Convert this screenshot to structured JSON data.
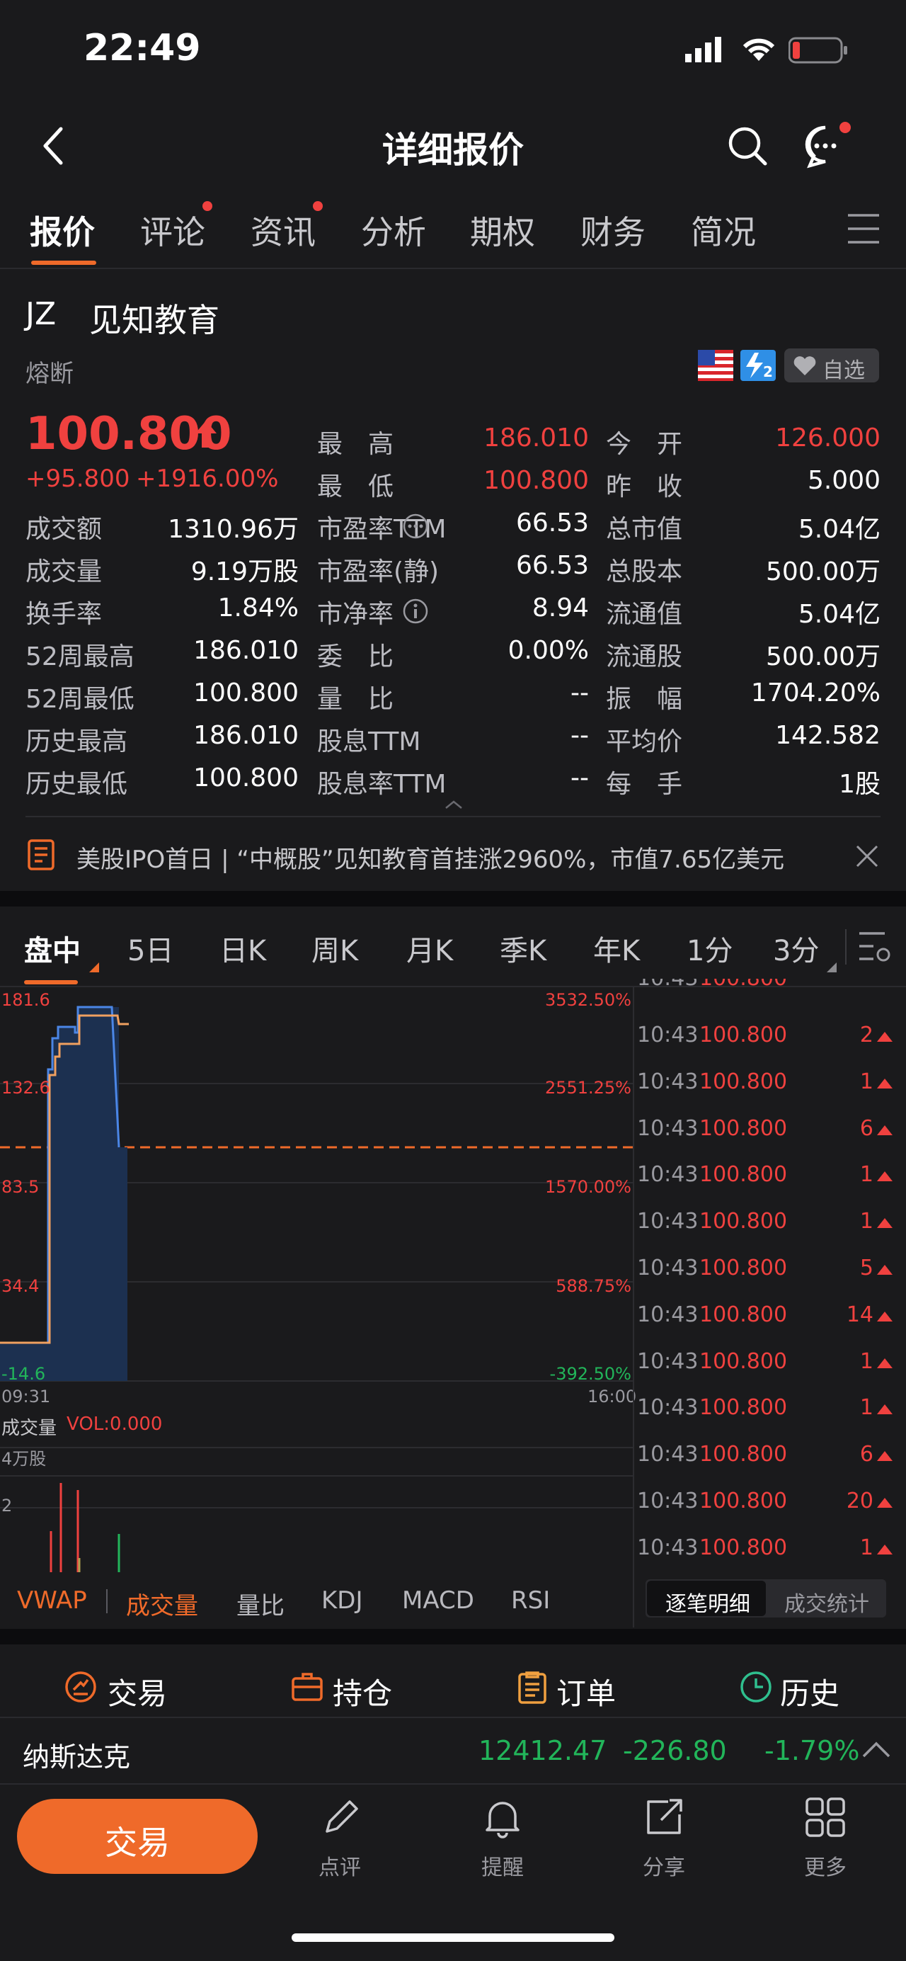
{
  "status": {
    "time": "22:49"
  },
  "nav": {
    "title": "详细报价"
  },
  "tabs": [
    "报价",
    "评论",
    "资讯",
    "分析",
    "期权",
    "财务",
    "简况"
  ],
  "stock": {
    "ticker": "JZ",
    "name": "见知教育",
    "state": "熔断",
    "watch_label": "自选",
    "price": "100.800",
    "change": "+95.800",
    "change_pct": "+1916.00%"
  },
  "quote_top": [
    {
      "label": "最　高",
      "value": "186.010",
      "color": "red",
      "label2": "今　开",
      "value2": "126.000",
      "color2": "red"
    },
    {
      "label": "最　低",
      "value": "100.800",
      "color": "red",
      "label2": "昨　收",
      "value2": "5.000",
      "color2": "white"
    }
  ],
  "quote_rows": [
    {
      "l1": "成交额",
      "v1": "1310.96万",
      "l2": "市盈率TTM",
      "v2": "66.53",
      "l3": "总市值",
      "v3": "5.04亿"
    },
    {
      "l1": "成交量",
      "v1": "9.19万股",
      "l2": "市盈率(静)",
      "v2": "66.53",
      "l3": "总股本",
      "v3": "500.00万"
    },
    {
      "l1": "换手率",
      "v1": "1.84%",
      "l2": "市净率",
      "v2": "8.94",
      "l3": "流通值",
      "v3": "5.04亿"
    },
    {
      "l1": "52周最高",
      "v1": "186.010",
      "l2": "委　比",
      "v2": "0.00%",
      "l3": "流通股",
      "v3": "500.00万"
    },
    {
      "l1": "52周最低",
      "v1": "100.800",
      "l2": "量　比",
      "v2": "--",
      "l3": "振　幅",
      "v3": "1704.20%"
    },
    {
      "l1": "历史最高",
      "v1": "186.010",
      "l2": "股息TTM",
      "v2": "--",
      "l3": "平均价",
      "v3": "142.582"
    },
    {
      "l1": "历史最低",
      "v1": "100.800",
      "l2": "股息率TTM",
      "v2": "--",
      "l3": "每　手",
      "v3": "1股"
    }
  ],
  "news": {
    "text": "美股IPO首日 | “中概股”见知教育首挂涨2960%，市值7.65亿美元"
  },
  "periods": [
    "盘中",
    "5日",
    "日K",
    "周K",
    "月K",
    "季K",
    "年K",
    "1分",
    "3分"
  ],
  "chart": {
    "left_ticks": [
      "181.6",
      "132.6",
      "83.5",
      "34.4",
      "-14.6"
    ],
    "right_ticks": [
      "3532.50%",
      "2551.25%",
      "1570.00%",
      "588.75%",
      "-392.50%"
    ],
    "time_start": "09:31",
    "time_end": "16:00",
    "vol_label": "成交量",
    "vol_value": "VOL:0.000",
    "vol_tick_top": "4万股",
    "vol_tick_mid": "2"
  },
  "ticks": [
    {
      "time": "10:43",
      "price": "100.800",
      "vol": "2"
    },
    {
      "time": "10:43",
      "price": "100.800",
      "vol": "1"
    },
    {
      "time": "10:43",
      "price": "100.800",
      "vol": "6"
    },
    {
      "time": "10:43",
      "price": "100.800",
      "vol": "1"
    },
    {
      "time": "10:43",
      "price": "100.800",
      "vol": "1"
    },
    {
      "time": "10:43",
      "price": "100.800",
      "vol": "5"
    },
    {
      "time": "10:43",
      "price": "100.800",
      "vol": "14"
    },
    {
      "time": "10:43",
      "price": "100.800",
      "vol": "1"
    },
    {
      "time": "10:43",
      "price": "100.800",
      "vol": "1"
    },
    {
      "time": "10:43",
      "price": "100.800",
      "vol": "6"
    },
    {
      "time": "10:43",
      "price": "100.800",
      "vol": "20"
    },
    {
      "time": "10:43",
      "price": "100.800",
      "vol": "1"
    }
  ],
  "indicators": [
    "VWAP",
    "成交量",
    "量比",
    "KDJ",
    "MACD",
    "RSI"
  ],
  "tick_tabs": [
    "逐笔明细",
    "成交统计"
  ],
  "actions": [
    "交易",
    "持仓",
    "订单",
    "历史"
  ],
  "index": {
    "name": "纳斯达克",
    "value": "12412.47",
    "change": "-226.80",
    "pct": "-1.79%"
  },
  "bottom": {
    "trade": "交易",
    "items": [
      "点评",
      "提醒",
      "分享",
      "更多"
    ]
  },
  "colors": {
    "up": "#f0413f",
    "down": "#22b55a",
    "accent": "#ef6a2a",
    "bg": "#1a1a1c"
  }
}
